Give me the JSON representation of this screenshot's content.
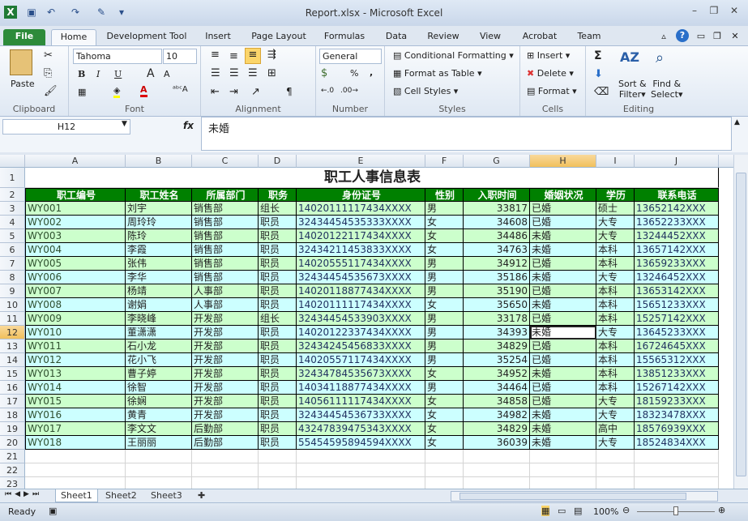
{
  "window": {
    "title": "Report.xlsx - Microsoft Excel",
    "app_icon": "excel-icon"
  },
  "ribbon_tabs": [
    "File",
    "Home",
    "Development Tool",
    "Insert",
    "Page Layout",
    "Formulas",
    "Data",
    "Review",
    "View",
    "Acrobat",
    "Team"
  ],
  "active_tab": "Home",
  "ribbon": {
    "clipboard": {
      "paste": "Paste",
      "label": "Clipboard"
    },
    "font": {
      "name": "Tahoma",
      "size": "10",
      "label": "Font",
      "bold": "B",
      "italic": "I",
      "underline": "U"
    },
    "alignment": {
      "label": "Alignment"
    },
    "number": {
      "format": "General",
      "percent": "%",
      "comma": ",",
      "label": "Number"
    },
    "styles": {
      "conditional": "Conditional Formatting",
      "format_table": "Format as Table",
      "cell_styles": "Cell Styles",
      "label": "Styles"
    },
    "cells": {
      "insert": "Insert",
      "delete": "Delete",
      "format": "Format",
      "label": "Cells"
    },
    "editing": {
      "sort1": "Sort &",
      "sort2": "Filter",
      "find1": "Find &",
      "find2": "Select",
      "label": "Editing",
      "sum": "Σ"
    }
  },
  "formula_bar": {
    "name_box": "H12",
    "fx": "fx",
    "value": "未婚"
  },
  "columns": [
    "A",
    "B",
    "C",
    "D",
    "E",
    "F",
    "G",
    "H",
    "I",
    "J"
  ],
  "selected_cell": {
    "col": "H",
    "row": 12
  },
  "sheet": {
    "title": "职工人事信息表",
    "headers": [
      "职工编号",
      "职工姓名",
      "所属部门",
      "职务",
      "身份证号",
      "性别",
      "入职时间",
      "婚姻状况",
      "学历",
      "联系电话"
    ],
    "rows": [
      [
        "WY001",
        "刘宇",
        "销售部",
        "组长",
        "14020111117434XXXX",
        "男",
        "33817",
        "已婚",
        "硕士",
        "13652142XXX"
      ],
      [
        "WY002",
        "周玲玲",
        "销售部",
        "职员",
        "32434454535333XXXX",
        "女",
        "34608",
        "已婚",
        "大专",
        "13652233XXX"
      ],
      [
        "WY003",
        "陈玲",
        "销售部",
        "职员",
        "14020122117434XXXX",
        "女",
        "34486",
        "未婚",
        "大专",
        "13244452XXX"
      ],
      [
        "WY004",
        "李霞",
        "销售部",
        "职员",
        "32434211453833XXXX",
        "女",
        "34763",
        "未婚",
        "本科",
        "13657142XXX"
      ],
      [
        "WY005",
        "张伟",
        "销售部",
        "职员",
        "14020555117434XXXX",
        "男",
        "34912",
        "已婚",
        "本科",
        "13659233XXX"
      ],
      [
        "WY006",
        "李华",
        "销售部",
        "职员",
        "32434454535673XXXX",
        "男",
        "35186",
        "未婚",
        "大专",
        "13246452XXX"
      ],
      [
        "WY007",
        "杨靖",
        "人事部",
        "职员",
        "14020118877434XXXX",
        "男",
        "35190",
        "已婚",
        "本科",
        "13653142XXX"
      ],
      [
        "WY008",
        "谢娟",
        "人事部",
        "职员",
        "14020111117434XXXX",
        "女",
        "35650",
        "未婚",
        "本科",
        "15651233XXX"
      ],
      [
        "WY009",
        "李晓峰",
        "开发部",
        "组长",
        "32434454533903XXXX",
        "男",
        "33178",
        "已婚",
        "本科",
        "15257142XXX"
      ],
      [
        "WY010",
        "董潇潇",
        "开发部",
        "职员",
        "14020122337434XXXX",
        "男",
        "34393",
        "未婚",
        "大专",
        "13645233XXX"
      ],
      [
        "WY011",
        "石小龙",
        "开发部",
        "职员",
        "32434245456833XXXX",
        "男",
        "34829",
        "已婚",
        "本科",
        "16724645XXX"
      ],
      [
        "WY012",
        "花小飞",
        "开发部",
        "职员",
        "14020557117434XXXX",
        "男",
        "35254",
        "已婚",
        "本科",
        "15565312XXX"
      ],
      [
        "WY013",
        "曹子婷",
        "开发部",
        "职员",
        "32434784535673XXXX",
        "女",
        "34952",
        "未婚",
        "本科",
        "13851233XXX"
      ],
      [
        "WY014",
        "徐智",
        "开发部",
        "职员",
        "14034118877434XXXX",
        "男",
        "34464",
        "已婚",
        "本科",
        "15267142XXX"
      ],
      [
        "WY015",
        "徐娴",
        "开发部",
        "职员",
        "14056111117434XXXX",
        "女",
        "34858",
        "已婚",
        "大专",
        "18159233XXX"
      ],
      [
        "WY016",
        "黄青",
        "开发部",
        "职员",
        "32434454536733XXXX",
        "女",
        "34982",
        "未婚",
        "大专",
        "18323478XXX"
      ],
      [
        "WY017",
        "李文文",
        "后勤部",
        "职员",
        "43247839475343XXXX",
        "女",
        "34829",
        "未婚",
        "高中",
        "18576939XXX"
      ],
      [
        "WY018",
        "王丽丽",
        "后勤部",
        "职员",
        "55454595894594XXXX",
        "女",
        "36039",
        "未婚",
        "大专",
        "18524834XXX"
      ]
    ]
  },
  "colors": {
    "header_bg": "#008000",
    "row_green": "#ccffcc",
    "row_cyan": "#ccffff"
  },
  "sheet_tabs": [
    "Sheet1",
    "Sheet2",
    "Sheet3"
  ],
  "active_sheet": "Sheet1",
  "status": {
    "ready": "Ready",
    "zoom": "100%"
  }
}
